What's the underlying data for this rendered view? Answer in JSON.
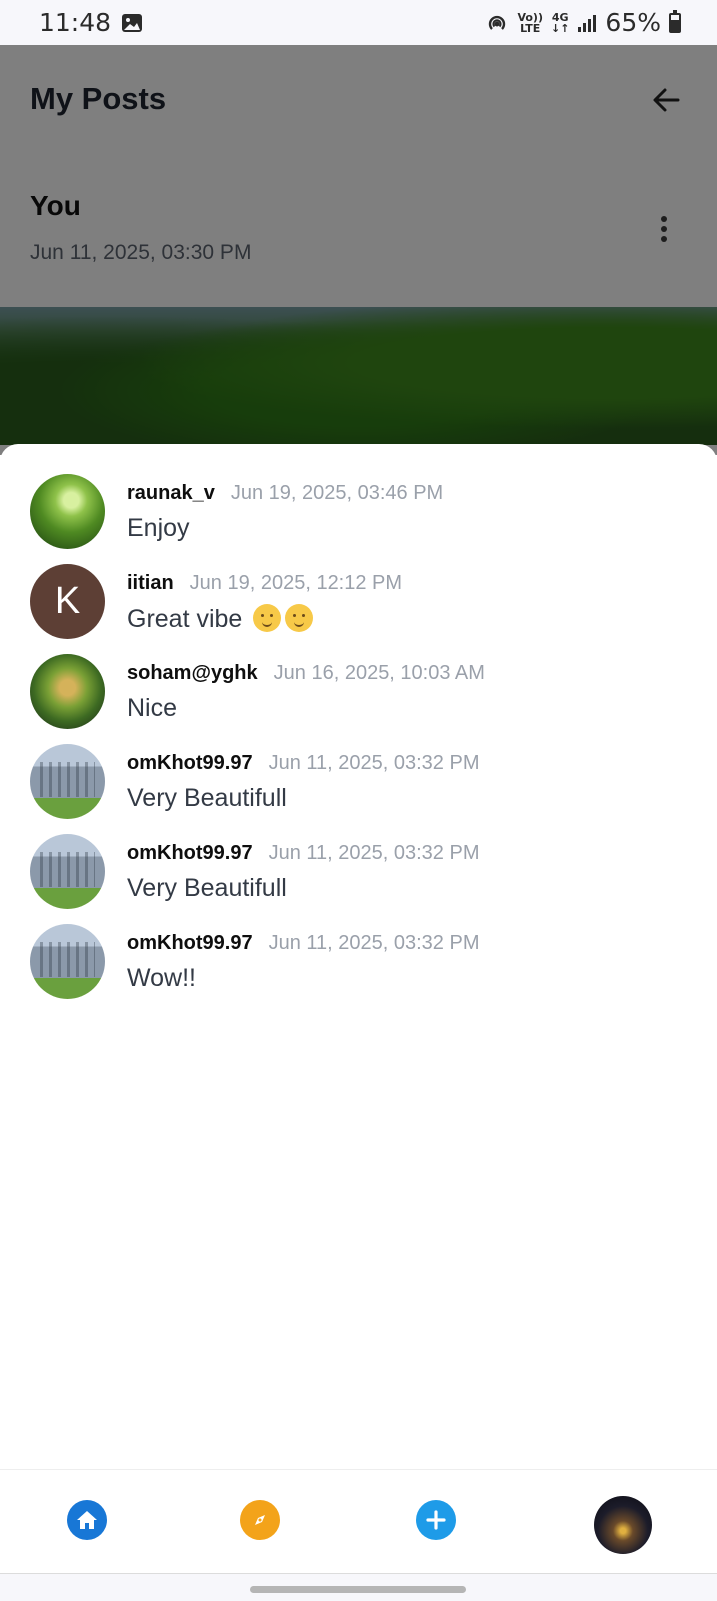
{
  "status_bar": {
    "time": "11:48",
    "network_volte": "Vo))",
    "network_lte": "LTE",
    "network_4g": "4G",
    "battery": "65%",
    "battery_level": 0.65,
    "icons": [
      "gallery-icon",
      "hotspot-icon",
      "signal-icon",
      "battery-icon"
    ]
  },
  "header": {
    "title": "My Posts"
  },
  "post": {
    "author": "You",
    "date": "Jun 11, 2025, 03:30 PM"
  },
  "comments": [
    {
      "user": "raunak_v",
      "time": "Jun 19, 2025, 03:46 PM",
      "text": "Enjoy",
      "avatar": "forest-photo"
    },
    {
      "user": "iitian",
      "time": "Jun 19, 2025, 12:12 PM",
      "text": "Great vibe",
      "avatar": "K",
      "emoji_count": 2
    },
    {
      "user": "soham@yghk",
      "time": "Jun 16, 2025, 10:03 AM",
      "text": "Nice",
      "avatar": "boat-photo"
    },
    {
      "user": "omKhot99.97",
      "time": "Jun 11, 2025, 03:32 PM",
      "text": "Very Beautifull",
      "avatar": "building-photo"
    },
    {
      "user": "omKhot99.97",
      "time": "Jun 11, 2025, 03:32 PM",
      "text": "Very Beautifull",
      "avatar": "building-photo"
    },
    {
      "user": "omKhot99.97",
      "time": "Jun 11, 2025, 03:32 PM",
      "text": "Wow!!",
      "avatar": "building-photo"
    }
  ],
  "bottom_nav": {
    "items": [
      "home-icon",
      "explore-icon",
      "add-icon",
      "profile-avatar"
    ]
  },
  "colors": {
    "home": "#1877d6",
    "explore": "#f3a31a",
    "add": "#1e9be8"
  }
}
